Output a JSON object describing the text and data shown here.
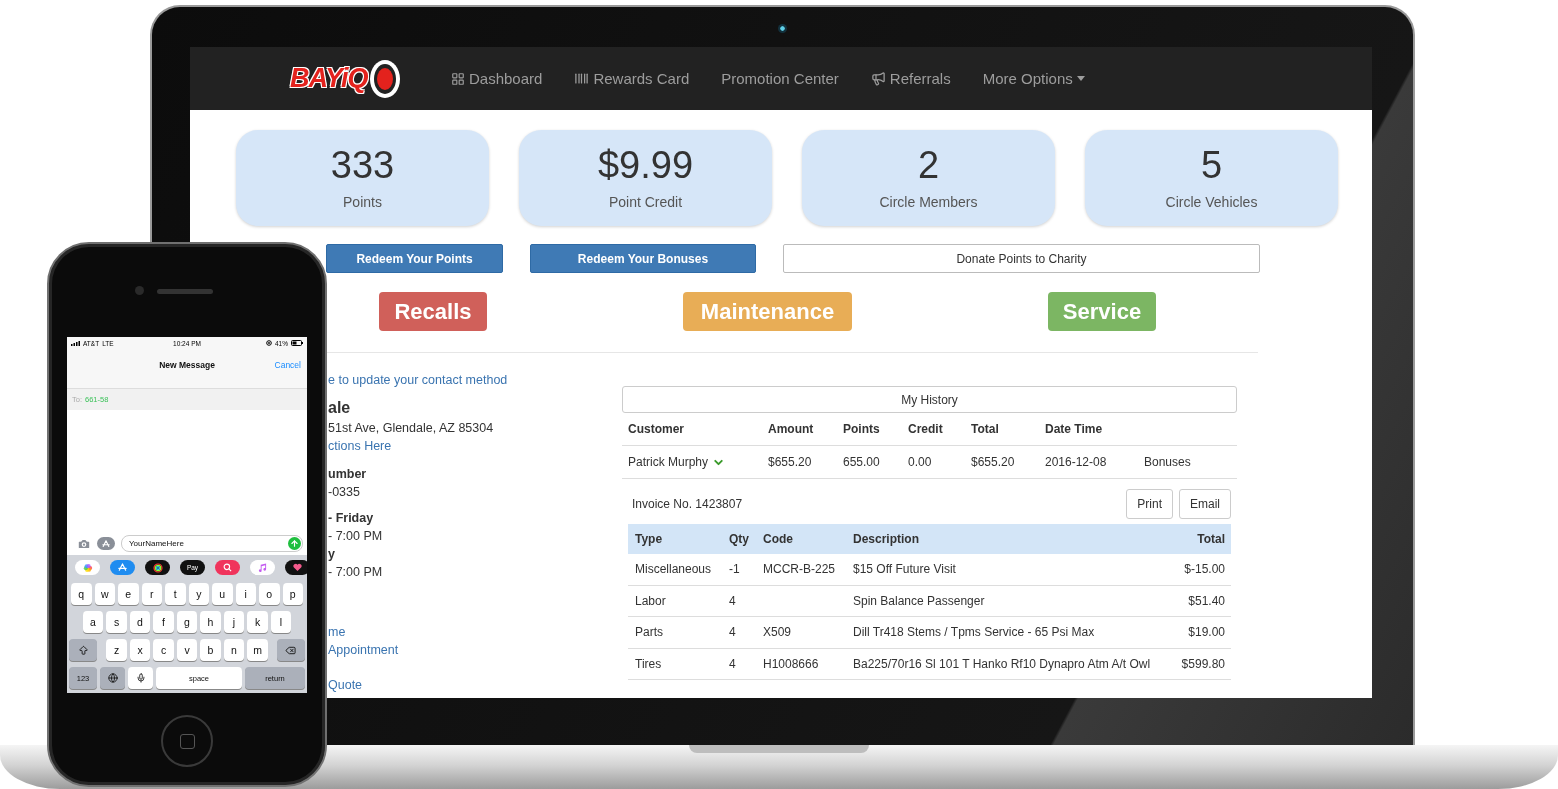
{
  "nav": {
    "logo": "BAYiQ",
    "items": [
      {
        "label": "Dashboard",
        "dropdown": false
      },
      {
        "label": "Rewards Card",
        "dropdown": false
      },
      {
        "label": "Promotion Center",
        "dropdown": false
      },
      {
        "label": "Referrals",
        "dropdown": false
      },
      {
        "label": "More Options",
        "dropdown": true
      }
    ]
  },
  "stats": [
    {
      "value": "333",
      "label": "Points"
    },
    {
      "value": "$9.99",
      "label": "Point Credit"
    },
    {
      "value": "2",
      "label": "Circle Members"
    },
    {
      "value": "5",
      "label": "Circle Vehicles"
    }
  ],
  "actions": [
    {
      "label": "Redeem Your Points",
      "kind": "primary"
    },
    {
      "label": "Redeem Your Bonuses",
      "kind": "primary"
    },
    {
      "label": "Donate Points to Charity",
      "kind": "outline"
    }
  ],
  "categories": [
    {
      "label": "Recalls",
      "color": "#d0605a"
    },
    {
      "label": "Maintenance",
      "color": "#e8ad56"
    },
    {
      "label": "Service",
      "color": "#7cb663"
    }
  ],
  "contact": {
    "blocks": [
      [
        {
          "text": "e to update your contact method",
          "kind": "link"
        }
      ],
      [
        {
          "text": "ale",
          "kind": "heading"
        },
        {
          "text": "51st Ave, Glendale, AZ 85304",
          "kind": "text"
        },
        {
          "text": "ctions Here",
          "kind": "link"
        }
      ],
      [
        {
          "text": "umber",
          "kind": "label"
        },
        {
          "text": "-0335",
          "kind": "text"
        }
      ],
      [
        {
          "text": "- Friday",
          "kind": "label"
        },
        {
          "text": "- 7:00 PM",
          "kind": "text"
        },
        {
          "text": "y",
          "kind": "label"
        },
        {
          "text": "- 7:00 PM",
          "kind": "text"
        }
      ],
      [
        {
          "text": "me",
          "kind": "link"
        },
        {
          "text": "Appointment",
          "kind": "link"
        }
      ],
      [
        {
          "text": "Quote",
          "kind": "link"
        }
      ]
    ]
  },
  "history": {
    "title": "My History",
    "columns": [
      "Customer",
      "Amount",
      "Points",
      "Credit",
      "Total",
      "Date Time"
    ],
    "rows": [
      {
        "cells": [
          "Patrick Murphy",
          "$655.20",
          "655.00",
          "0.00",
          "$655.20",
          "2016-12-08",
          "Bonuses"
        ],
        "expanded": true
      }
    ]
  },
  "invoice": {
    "number": "Invoice No. 1423807",
    "buttons": [
      "Print",
      "Email"
    ],
    "columns": [
      "Type",
      "Qty",
      "Code",
      "Description",
      "Total"
    ],
    "rows": [
      {
        "type": "Miscellaneous",
        "qty": "-1",
        "code": "MCCR-B-225",
        "description": "$15 Off Future Visit",
        "total": "$-15.00"
      },
      {
        "type": "Labor",
        "qty": "4",
        "description": "Spin Balance Passenger",
        "total": "$51.40"
      },
      {
        "type": "Parts",
        "qty": "4",
        "code": "X509",
        "description": "Dill Tr418 Stems / Tpms Service - 65 Psi Max",
        "total": "$19.00"
      },
      {
        "type": "Tires",
        "qty": "4",
        "code": "H1008666",
        "description": "Ba225/70r16 Sl 101 T Hanko Rf10 Dynapro Atm A/t Owl",
        "total": "$599.80"
      }
    ]
  },
  "phone": {
    "status": {
      "carrier": "AT&T",
      "network": "LTE",
      "time": "10:24 PM",
      "battery": "41%"
    },
    "header": {
      "title": "New Message",
      "action": "Cancel"
    },
    "to": {
      "label": "To:",
      "value": "661-58"
    },
    "compose": {
      "value": "YourNameHere"
    },
    "apps": [
      {
        "kind": "photos"
      },
      {
        "kind": "appstore"
      },
      {
        "kind": "activity"
      },
      {
        "kind": "pay",
        "label": "Pay"
      },
      {
        "kind": "search"
      },
      {
        "kind": "music"
      },
      {
        "kind": "heart"
      }
    ],
    "keyboard": {
      "rows": [
        [
          "q",
          "w",
          "e",
          "r",
          "t",
          "y",
          "u",
          "i",
          "o",
          "p"
        ],
        [
          "a",
          "s",
          "d",
          "f",
          "g",
          "h",
          "j",
          "k",
          "l"
        ],
        [
          "z",
          "x",
          "c",
          "v",
          "b",
          "n",
          "m"
        ]
      ],
      "numbers": "123",
      "space": "space",
      "return": "return"
    }
  }
}
